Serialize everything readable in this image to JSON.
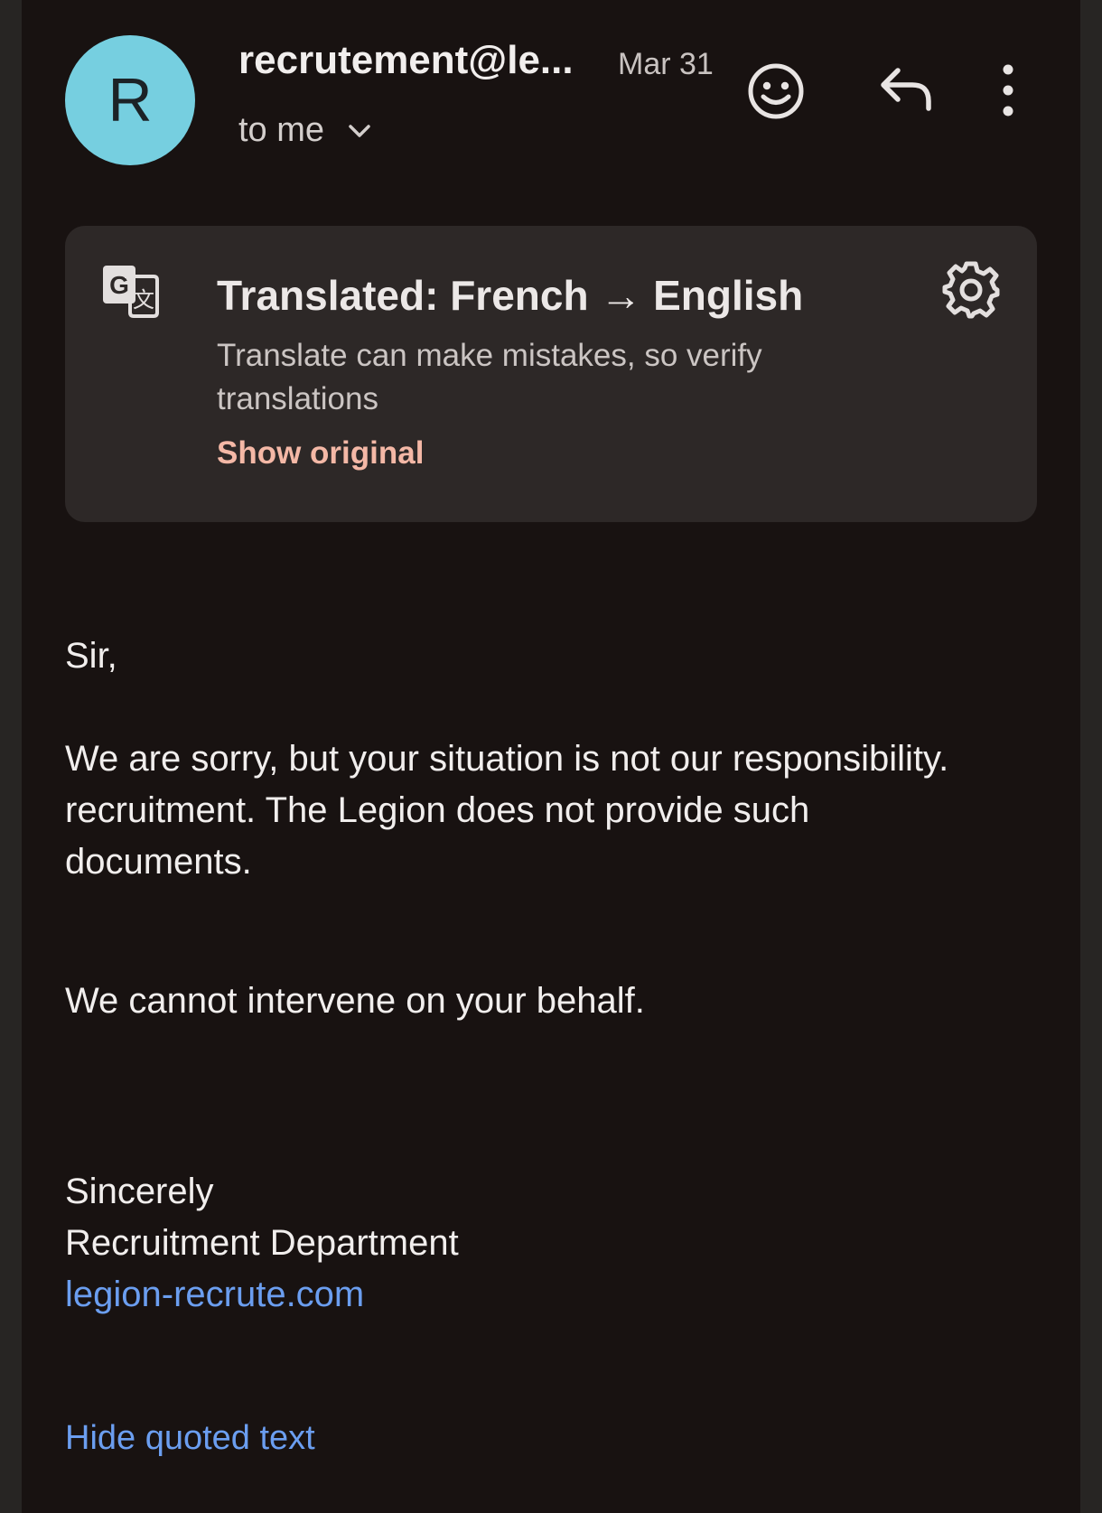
{
  "header": {
    "avatar_letter": "R",
    "sender": "recrutement@le...",
    "date": "Mar 31",
    "recipient": "to me",
    "icons": [
      "emoji-icon",
      "reply-icon",
      "more-vertical-icon",
      "chevron-down-icon"
    ]
  },
  "translation": {
    "title": "Translated: French → English",
    "subtitle": "Translate can make mistakes, so verify translations",
    "show_original": "Show original",
    "icons": [
      "translate-icon",
      "gear-icon"
    ]
  },
  "body": {
    "greeting": "Sir,",
    "paragraph1_line1": "We are sorry, but your situation is not our responsibility.",
    "paragraph1_line2": "recruitment. The Legion does not provide such documents.",
    "paragraph2": "We cannot intervene on your behalf.",
    "closing": "Sincerely",
    "signature": "Recruitment Department",
    "link": "legion-recrute.com",
    "hide_quoted": "Hide quoted text"
  },
  "colors": {
    "background": "#181211",
    "avatar": "#76cfe0",
    "card": "#2d2827",
    "accent_link": "#6b9ef0",
    "show_original": "#f4b8a6"
  }
}
